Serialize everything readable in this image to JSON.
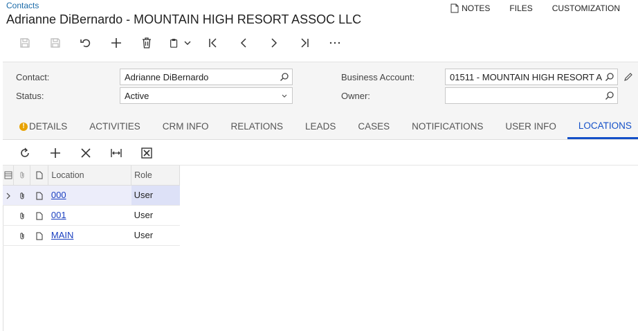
{
  "breadcrumb": "Contacts",
  "title": "Adrianne DiBernardo - MOUNTAIN HIGH RESORT ASSOC LLC",
  "top_links": {
    "notes": "NOTES",
    "files": "FILES",
    "customization": "CUSTOMIZATION"
  },
  "toolbar": {
    "icons": [
      "save-icon",
      "save-close-icon",
      "undo-icon",
      "add-icon",
      "delete-icon",
      "copy-paste-icon",
      "first-icon",
      "previous-icon",
      "next-icon",
      "last-icon",
      "more-icon"
    ]
  },
  "form": {
    "contact_label": "Contact:",
    "contact_value": "Adrianne DiBernardo",
    "status_label": "Status:",
    "status_value": "Active",
    "business_account_label": "Business Account:",
    "business_account_value": "01511 - MOUNTAIN HIGH RESORT A",
    "owner_label": "Owner:",
    "owner_value": ""
  },
  "tabs": [
    {
      "label": "DETAILS",
      "warning": true
    },
    {
      "label": "ACTIVITIES"
    },
    {
      "label": "CRM INFO"
    },
    {
      "label": "RELATIONS"
    },
    {
      "label": "LEADS"
    },
    {
      "label": "CASES"
    },
    {
      "label": "NOTIFICATIONS"
    },
    {
      "label": "USER INFO"
    },
    {
      "label": "LOCATIONS",
      "active": true
    }
  ],
  "grid": {
    "columns": {
      "location": "Location",
      "role": "Role"
    },
    "rows": [
      {
        "location": "000",
        "role": "User",
        "selected": true
      },
      {
        "location": "001",
        "role": "User"
      },
      {
        "location": "MAIN",
        "role": "User"
      }
    ]
  },
  "colors": {
    "accent": "#1450c8",
    "link": "#1a3fc0",
    "selected_row": "#dde1f7",
    "warning": "#e8a200"
  }
}
